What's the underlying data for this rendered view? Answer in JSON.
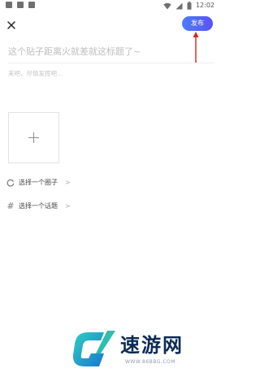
{
  "status_bar": {
    "time": "12:02"
  },
  "toolbar": {
    "close_icon": "close-icon",
    "publish_label": "发布",
    "publish_color": "#5b6cf6"
  },
  "composer": {
    "title_placeholder": "这个贴子距离火就差就这标题了~",
    "body_placeholder": "来吧，尽情发挥吧...",
    "add_image_icon": "plus-icon"
  },
  "options": [
    {
      "icon": "circle-icon",
      "label": "选择一个圈子",
      "chevron": ">"
    },
    {
      "icon": "hash-icon",
      "label": "选择一个话题",
      "chevron": ">"
    }
  ],
  "annotation": {
    "arrow_color": "#e02020"
  },
  "watermark": {
    "name": "速游网",
    "url": "WWW.86BBG.COM"
  }
}
